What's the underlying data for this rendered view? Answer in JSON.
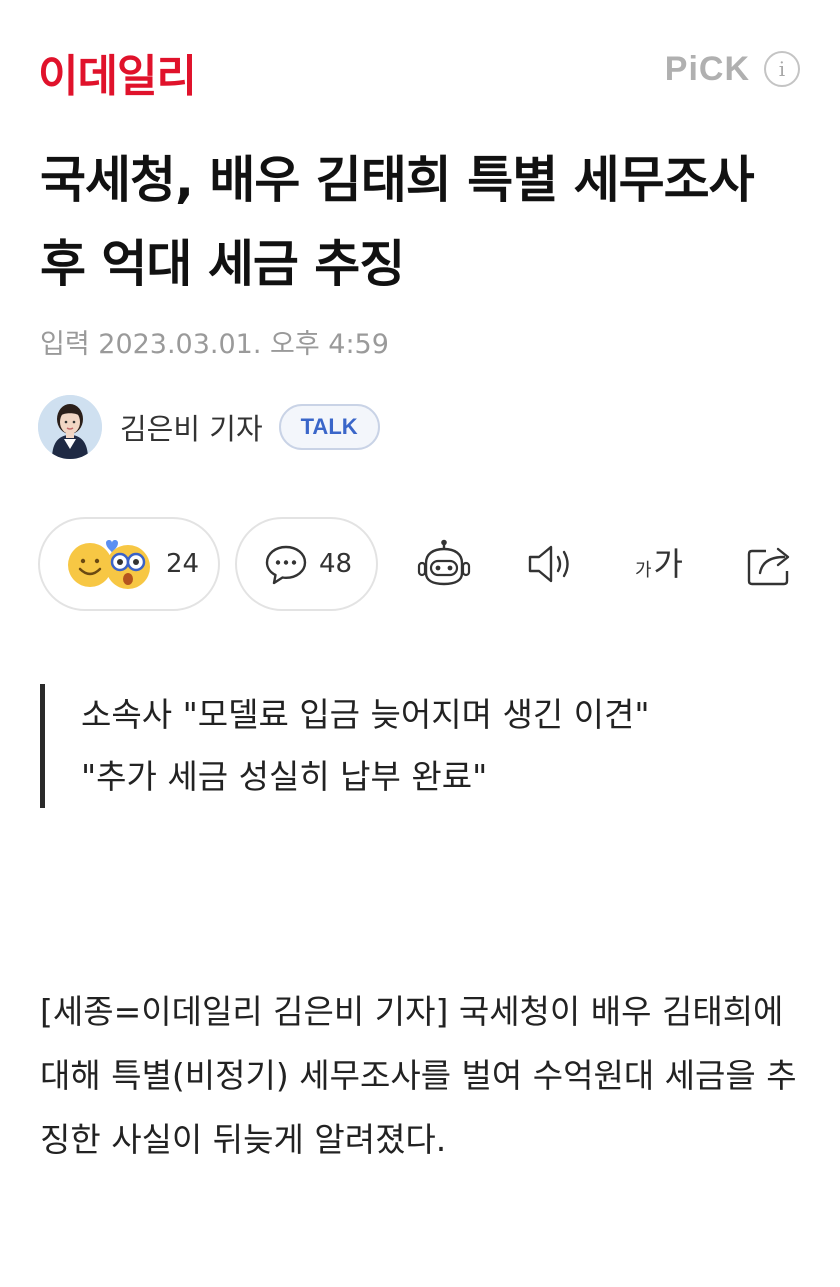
{
  "header": {
    "logo_text": "이데일리",
    "pick_label": "PiCK",
    "info_label": "i"
  },
  "article": {
    "title": "국세청, 배우 김태희 특별 세무조사 후 억대 세금 추징",
    "published": "입력 2023.03.01. 오후 4:59",
    "reporter_name": "김은비 기자",
    "talk_label": "TALK",
    "reaction_count": "24",
    "comment_count": "48",
    "font_size_label_small": "가",
    "font_size_label_large": "가",
    "subheads": [
      "소속사 \"모델료 입금 늦어지며 생긴 이견\"",
      "\"추가 세금 성실히 납부 완료\""
    ],
    "body": "[세종=이데일리 김은비 기자] 국세청이 배우 김태희에 대해 특별(비정기) 세무조사를 벌여 수억원대 세금을 추징한 사실이 뒤늦게 알려졌다."
  },
  "icons": {
    "reaction": "smile-and-surprise-emoji-icon",
    "comment": "speech-bubble-icon",
    "summary_bot": "robot-icon",
    "listen": "speaker-icon",
    "font_size": "font-size-icon",
    "share": "share-icon"
  },
  "colors": {
    "brand_red": "#e0122b",
    "talk_blue": "#3a66c9",
    "muted_gray": "#9a9a9a"
  }
}
